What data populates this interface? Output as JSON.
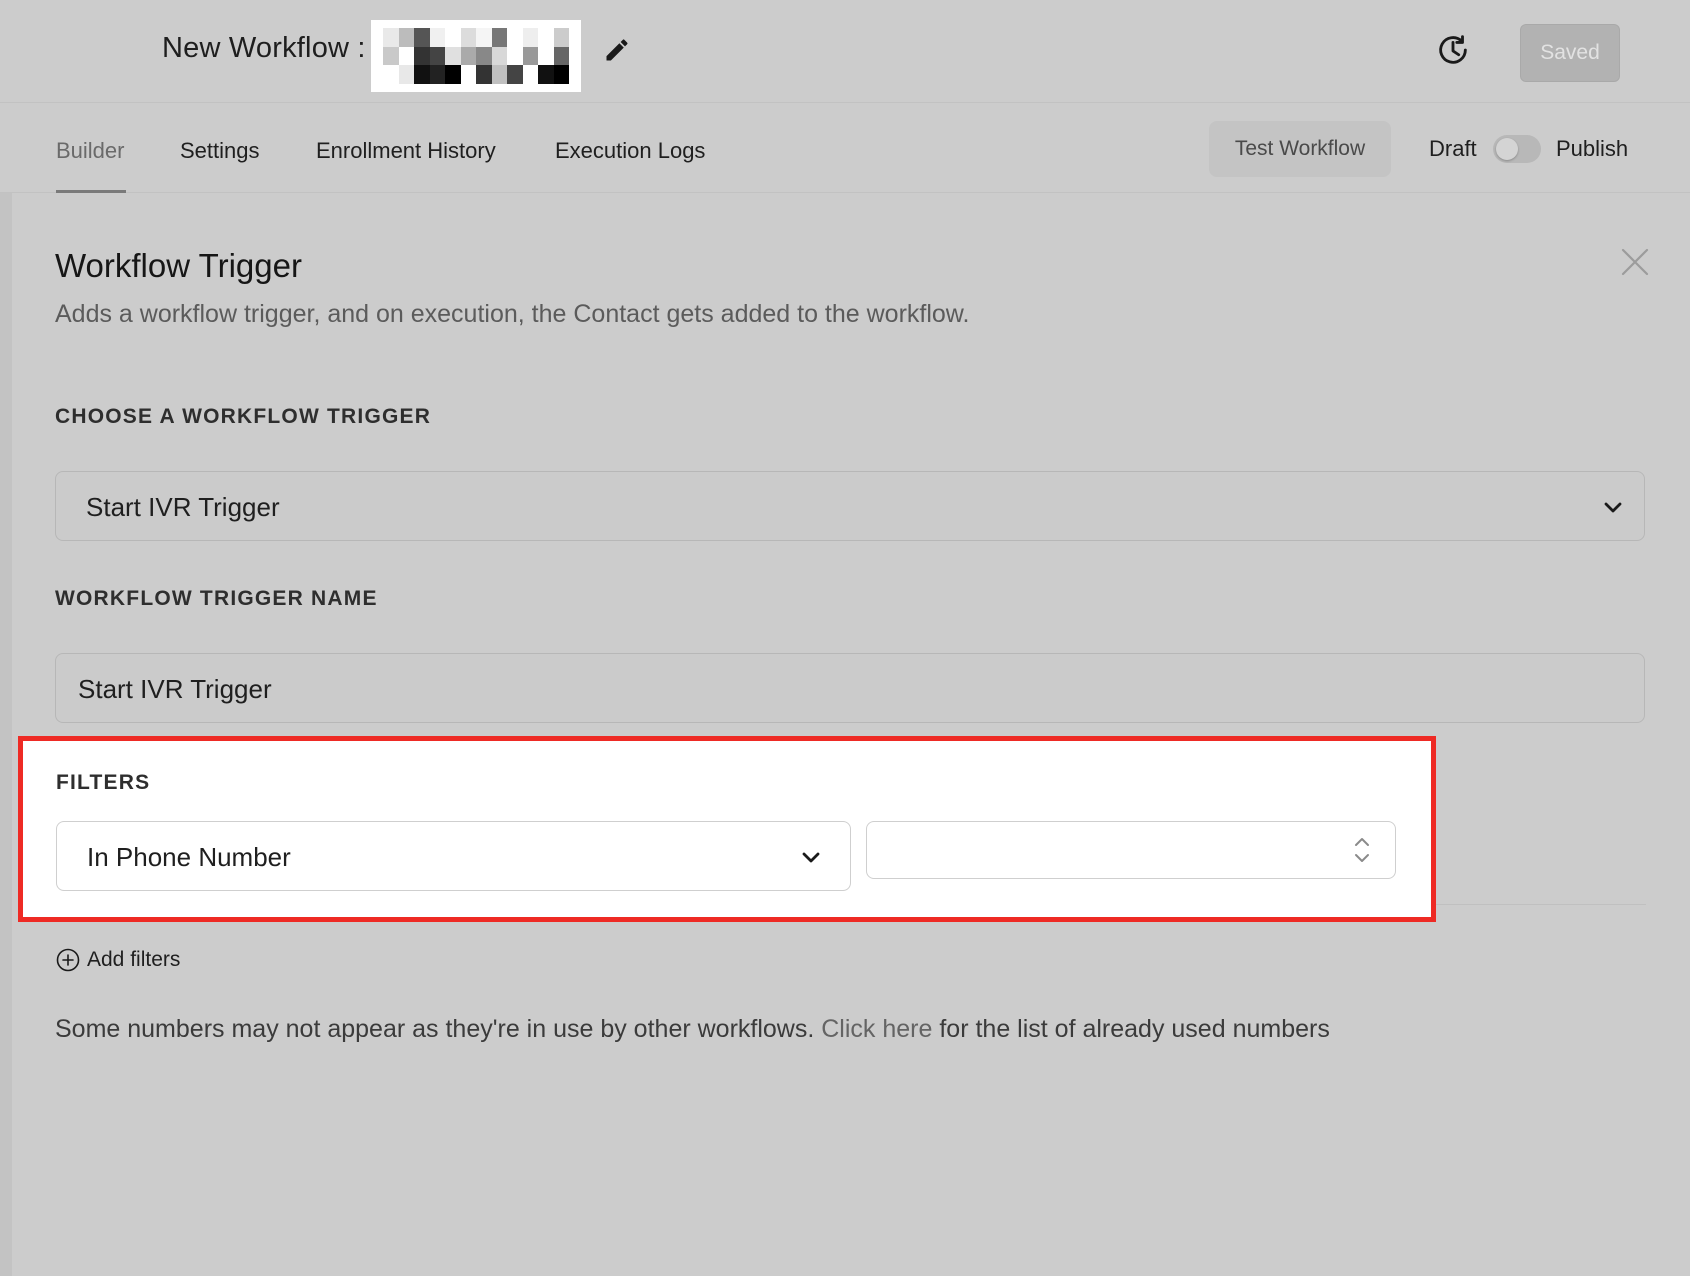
{
  "header": {
    "title": "New Workflow :",
    "saved_label": "Saved"
  },
  "icons": {
    "edit": "pencil-icon",
    "history": "history-clock-icon",
    "close": "close-icon",
    "chevron": "chevron-down-icon",
    "spinner": "up-down-spinner-icon",
    "add": "plus-circle-icon"
  },
  "tabs": [
    {
      "label": "Builder",
      "active": true
    },
    {
      "label": "Settings",
      "active": false
    },
    {
      "label": "Enrollment History",
      "active": false
    },
    {
      "label": "Execution Logs",
      "active": false
    }
  ],
  "toolbar": {
    "test_label": "Test Workflow",
    "draft_label": "Draft",
    "publish_label": "Publish",
    "published": false
  },
  "panel": {
    "title": "Workflow Trigger",
    "description": "Adds a workflow trigger, and on execution, the Contact gets added to the workflow.",
    "choose_label": "CHOOSE A WORKFLOW TRIGGER",
    "trigger_value": "Start IVR Trigger",
    "name_label": "WORKFLOW TRIGGER NAME",
    "name_value": "Start IVR Trigger"
  },
  "filters": {
    "label": "FILTERS",
    "field_value": "In Phone Number",
    "number_value": "",
    "add_label": "Add filters"
  },
  "note": {
    "before": "Some numbers may not appear as they're in use by other workflows. ",
    "link": "Click here",
    "after": " for the list of already used numbers"
  },
  "colors": {
    "highlight_border": "#ee2a24",
    "background": "#cccccc"
  }
}
